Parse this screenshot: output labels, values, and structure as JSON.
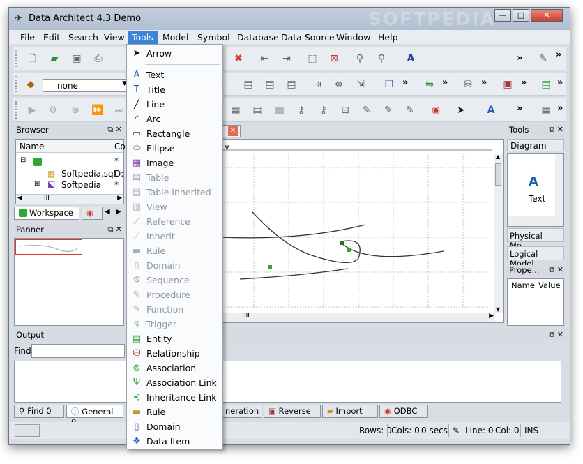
{
  "window": {
    "title": "Data Architect 4.3 Demo",
    "watermark": "SOFTPEDIA",
    "min_label": "—",
    "max_label": "□",
    "close_label": "✕"
  },
  "menu": [
    "File",
    "Edit",
    "Search",
    "View",
    "Tools",
    "Model",
    "Symbol",
    "Database",
    "Data Source",
    "Window",
    "Help"
  ],
  "toolbar": {
    "combo_value": "none",
    "more": "»"
  },
  "browser": {
    "title": "Browser",
    "col_name": "Name",
    "col_2": "Co",
    "items": [
      {
        "label": "Softpedia.sql",
        "col": "D:"
      },
      {
        "label": "Softpedia",
        "col": "*"
      }
    ],
    "root_col": "*",
    "scroll_label": "III",
    "tab_label": "Workspace"
  },
  "panner": {
    "title": "Panner"
  },
  "diagram": {
    "tab_close": "✕",
    "hscroll_label": "III"
  },
  "tools_panel": {
    "title": "Tools",
    "section": "Diagram",
    "tool_label": "Text",
    "section2": "Physical Mo...",
    "section3": "Logical Model"
  },
  "properties": {
    "title": "Prope...",
    "col_name": "Name",
    "col_value": "Value"
  },
  "output": {
    "title": "Output",
    "find_label": "Find",
    "tabs": [
      "Find 0",
      "General 0",
      "neration",
      "Reverse",
      "Import",
      "ODBC"
    ]
  },
  "status": {
    "rows": "Rows: 0",
    "cols": "Cols: 0",
    "secs": "0 secs",
    "line": "Line: 0",
    "col": "Col: 0",
    "ins": "INS"
  },
  "tools_menu": [
    {
      "label": "Arrow",
      "icon": "arrow-icon",
      "glyph": "➤",
      "enabled": true
    },
    {
      "label": "Text",
      "icon": "text-icon",
      "glyph": "A",
      "enabled": true
    },
    {
      "label": "Title",
      "icon": "title-icon",
      "glyph": "T",
      "enabled": true
    },
    {
      "label": "Line",
      "icon": "line-icon",
      "glyph": "╱",
      "enabled": true
    },
    {
      "label": "Arc",
      "icon": "arc-icon",
      "glyph": "◜",
      "enabled": true
    },
    {
      "label": "Rectangle",
      "icon": "rectangle-icon",
      "glyph": "▭",
      "enabled": true
    },
    {
      "label": "Ellipse",
      "icon": "ellipse-icon",
      "glyph": "⬭",
      "enabled": true
    },
    {
      "label": "Image",
      "icon": "image-icon",
      "glyph": "▦",
      "enabled": true
    },
    {
      "label": "Table",
      "icon": "table-icon",
      "glyph": "▤",
      "enabled": false
    },
    {
      "label": "Table Inherited",
      "icon": "table-inherited-icon",
      "glyph": "▤",
      "enabled": false
    },
    {
      "label": "View",
      "icon": "view-icon",
      "glyph": "▥",
      "enabled": false
    },
    {
      "label": "Reference",
      "icon": "reference-icon",
      "glyph": "⟋",
      "enabled": false
    },
    {
      "label": "Inherit",
      "icon": "inherit-icon",
      "glyph": "⟋",
      "enabled": false
    },
    {
      "label": "Rule",
      "icon": "rule-icon",
      "glyph": "▬",
      "enabled": false
    },
    {
      "label": "Domain",
      "icon": "domain-icon",
      "glyph": "▯",
      "enabled": false
    },
    {
      "label": "Sequence",
      "icon": "sequence-icon",
      "glyph": "⚙",
      "enabled": false
    },
    {
      "label": "Procedure",
      "icon": "procedure-icon",
      "glyph": "✎",
      "enabled": false
    },
    {
      "label": "Function",
      "icon": "function-icon",
      "glyph": "✎",
      "enabled": false
    },
    {
      "label": "Trigger",
      "icon": "trigger-icon",
      "glyph": "↯",
      "enabled": false
    },
    {
      "label": "Entity",
      "icon": "entity-icon",
      "glyph": "▤",
      "enabled": true
    },
    {
      "label": "Relationship",
      "icon": "relationship-icon",
      "glyph": "⛁",
      "enabled": true
    },
    {
      "label": "Association",
      "icon": "association-icon",
      "glyph": "⊜",
      "enabled": true
    },
    {
      "label": "Association Link",
      "icon": "association-link-icon",
      "glyph": "Ψ",
      "enabled": true
    },
    {
      "label": "Inheritance Link",
      "icon": "inheritance-link-icon",
      "glyph": "⊰",
      "enabled": true
    },
    {
      "label": "Rule",
      "icon": "rule-icon",
      "glyph": "▬",
      "enabled": true
    },
    {
      "label": "Domain",
      "icon": "domain-icon",
      "glyph": "▯",
      "enabled": true
    },
    {
      "label": "Data Item",
      "icon": "data-item-icon",
      "glyph": "❖",
      "enabled": true
    }
  ],
  "colors": {
    "menu_highlight": "#3d84d6",
    "close_red": "#d33b2c",
    "entity_green": "#31a636"
  }
}
